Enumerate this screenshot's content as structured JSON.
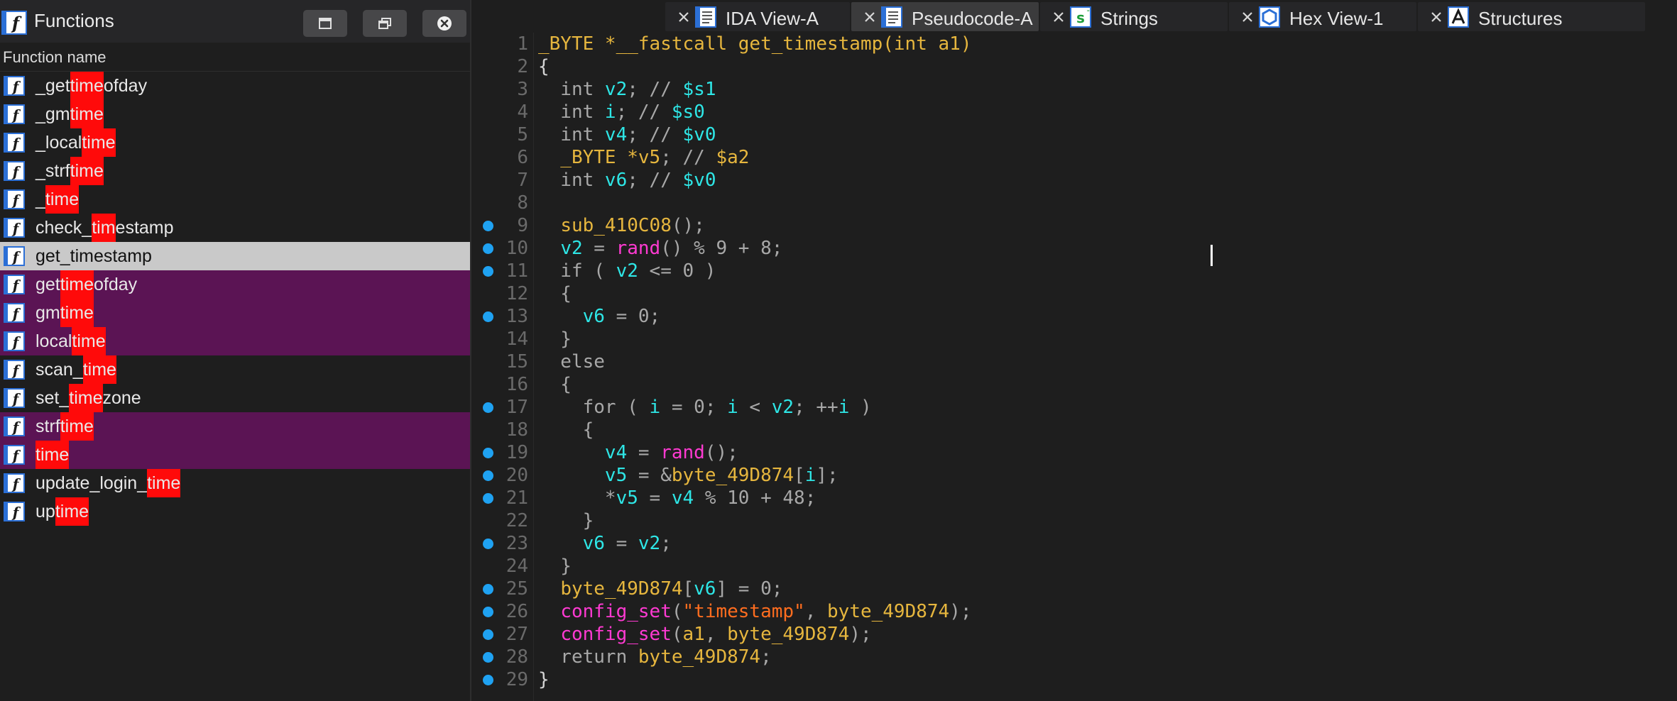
{
  "functions_panel": {
    "title": "Functions",
    "column_header": "Function name",
    "items": [
      {
        "segments": [
          {
            "t": "_get",
            "hl": false
          },
          {
            "t": "time",
            "hl": true
          },
          {
            "t": "ofday",
            "hl": false
          }
        ],
        "state": "normal"
      },
      {
        "segments": [
          {
            "t": "_gm",
            "hl": false
          },
          {
            "t": "time",
            "hl": true
          }
        ],
        "state": "normal"
      },
      {
        "segments": [
          {
            "t": "_local",
            "hl": false
          },
          {
            "t": "time",
            "hl": true
          }
        ],
        "state": "normal"
      },
      {
        "segments": [
          {
            "t": "_strf",
            "hl": false
          },
          {
            "t": "time",
            "hl": true
          }
        ],
        "state": "normal"
      },
      {
        "segments": [
          {
            "t": "_",
            "hl": false
          },
          {
            "t": "time",
            "hl": true
          }
        ],
        "state": "normal"
      },
      {
        "segments": [
          {
            "t": "check_",
            "hl": false
          },
          {
            "t": "tim",
            "hl": true
          },
          {
            "t": "estamp",
            "hl": false
          }
        ],
        "state": "normal"
      },
      {
        "segments": [
          {
            "t": "get_timestamp",
            "hl": false
          }
        ],
        "state": "selected"
      },
      {
        "segments": [
          {
            "t": "get",
            "hl": false
          },
          {
            "t": "time",
            "hl": true
          },
          {
            "t": "ofday",
            "hl": false
          }
        ],
        "state": "library"
      },
      {
        "segments": [
          {
            "t": "gm",
            "hl": false
          },
          {
            "t": "time",
            "hl": true
          }
        ],
        "state": "library"
      },
      {
        "segments": [
          {
            "t": "local",
            "hl": false
          },
          {
            "t": "time",
            "hl": true
          }
        ],
        "state": "library"
      },
      {
        "segments": [
          {
            "t": "scan_",
            "hl": false
          },
          {
            "t": "time",
            "hl": true
          }
        ],
        "state": "normal"
      },
      {
        "segments": [
          {
            "t": "set_",
            "hl": false
          },
          {
            "t": "time",
            "hl": true
          },
          {
            "t": "zone",
            "hl": false
          }
        ],
        "state": "normal"
      },
      {
        "segments": [
          {
            "t": "strf",
            "hl": false
          },
          {
            "t": "time",
            "hl": true
          }
        ],
        "state": "library"
      },
      {
        "segments": [
          {
            "t": "time",
            "hl": true
          }
        ],
        "state": "library"
      },
      {
        "segments": [
          {
            "t": "update_login_",
            "hl": false
          },
          {
            "t": "time",
            "hl": true
          }
        ],
        "state": "normal"
      },
      {
        "segments": [
          {
            "t": "up",
            "hl": false
          },
          {
            "t": "time",
            "hl": true
          }
        ],
        "state": "normal"
      }
    ]
  },
  "tabs": [
    {
      "label": "IDA View-A",
      "icon": "ida-view-icon",
      "active": false
    },
    {
      "label": "Pseudocode-A",
      "icon": "pseudocode-icon",
      "active": true
    },
    {
      "label": "Strings",
      "icon": "strings-icon",
      "active": false
    },
    {
      "label": "Hex View-1",
      "icon": "hex-view-icon",
      "active": false
    },
    {
      "label": "Structures",
      "icon": "structures-icon",
      "active": false
    }
  ],
  "code_lines": [
    {
      "n": "1",
      "bp": false,
      "tokens": [
        [
          "_BYTE *__fastcall get_timestamp(",
          "type"
        ],
        [
          "int",
          "type"
        ],
        [
          " a1)",
          "type"
        ]
      ]
    },
    {
      "n": "2",
      "bp": false,
      "tokens": [
        [
          "{",
          "txt"
        ]
      ]
    },
    {
      "n": "3",
      "bp": false,
      "tokens": [
        [
          "  int ",
          "var-dim"
        ],
        [
          "v2",
          "var"
        ],
        [
          "; // ",
          "dim"
        ],
        [
          "$s1",
          "var"
        ]
      ]
    },
    {
      "n": "4",
      "bp": false,
      "tokens": [
        [
          "  int ",
          "var-dim"
        ],
        [
          "i",
          "var"
        ],
        [
          "; // ",
          "dim"
        ],
        [
          "$s0",
          "var"
        ]
      ]
    },
    {
      "n": "5",
      "bp": false,
      "tokens": [
        [
          "  int ",
          "var-dim"
        ],
        [
          "v4",
          "var"
        ],
        [
          "; // ",
          "dim"
        ],
        [
          "$v0",
          "var"
        ]
      ]
    },
    {
      "n": "6",
      "bp": false,
      "tokens": [
        [
          "  _BYTE *",
          "type"
        ],
        [
          "v5",
          "type"
        ],
        [
          "; // ",
          "dim"
        ],
        [
          "$a2",
          "type"
        ]
      ]
    },
    {
      "n": "7",
      "bp": false,
      "tokens": [
        [
          "  int ",
          "var-dim"
        ],
        [
          "v6",
          "var"
        ],
        [
          "; // ",
          "dim"
        ],
        [
          "$v0",
          "var"
        ]
      ]
    },
    {
      "n": "8",
      "bp": false,
      "tokens": []
    },
    {
      "n": "9",
      "bp": true,
      "tokens": [
        [
          "  ",
          "txt"
        ],
        [
          "sub_410C08",
          "fn"
        ],
        [
          "();",
          "dim"
        ]
      ]
    },
    {
      "n": "10",
      "bp": true,
      "tokens": [
        [
          "  ",
          "txt"
        ],
        [
          "v2",
          "var"
        ],
        [
          " = ",
          "dim"
        ],
        [
          "rand",
          "call"
        ],
        [
          "() % 9 + 8;",
          "dim"
        ]
      ]
    },
    {
      "n": "11",
      "bp": true,
      "tokens": [
        [
          "  if ( ",
          "dim"
        ],
        [
          "v2",
          "var"
        ],
        [
          " <= 0 )",
          "dim"
        ]
      ]
    },
    {
      "n": "12",
      "bp": false,
      "tokens": [
        [
          "  {",
          "dim"
        ]
      ]
    },
    {
      "n": "13",
      "bp": true,
      "tokens": [
        [
          "    ",
          "txt"
        ],
        [
          "v6",
          "var"
        ],
        [
          " = 0;",
          "dim"
        ]
      ]
    },
    {
      "n": "14",
      "bp": false,
      "tokens": [
        [
          "  }",
          "dim"
        ]
      ]
    },
    {
      "n": "15",
      "bp": false,
      "tokens": [
        [
          "  else",
          "dim"
        ]
      ]
    },
    {
      "n": "16",
      "bp": false,
      "tokens": [
        [
          "  {",
          "dim"
        ]
      ]
    },
    {
      "n": "17",
      "bp": true,
      "tokens": [
        [
          "    for ( ",
          "dim"
        ],
        [
          "i",
          "var"
        ],
        [
          " = 0; ",
          "dim"
        ],
        [
          "i",
          "var"
        ],
        [
          " < ",
          "dim"
        ],
        [
          "v2",
          "var"
        ],
        [
          "; ++",
          "dim"
        ],
        [
          "i",
          "var"
        ],
        [
          " )",
          "dim"
        ]
      ]
    },
    {
      "n": "18",
      "bp": false,
      "tokens": [
        [
          "    {",
          "dim"
        ]
      ]
    },
    {
      "n": "19",
      "bp": true,
      "tokens": [
        [
          "      ",
          "txt"
        ],
        [
          "v4",
          "var"
        ],
        [
          " = ",
          "dim"
        ],
        [
          "rand",
          "call"
        ],
        [
          "();",
          "dim"
        ]
      ]
    },
    {
      "n": "20",
      "bp": true,
      "tokens": [
        [
          "      ",
          "txt"
        ],
        [
          "v5",
          "var"
        ],
        [
          " = &",
          "dim"
        ],
        [
          "byte_49D874",
          "fn"
        ],
        [
          "[",
          "dim"
        ],
        [
          "i",
          "var"
        ],
        [
          "];",
          "dim"
        ]
      ]
    },
    {
      "n": "21",
      "bp": true,
      "tokens": [
        [
          "      *",
          "dim"
        ],
        [
          "v5",
          "var"
        ],
        [
          " = ",
          "dim"
        ],
        [
          "v4",
          "var"
        ],
        [
          " % 10 + 48;",
          "dim"
        ]
      ]
    },
    {
      "n": "22",
      "bp": false,
      "tokens": [
        [
          "    }",
          "dim"
        ]
      ]
    },
    {
      "n": "23",
      "bp": true,
      "tokens": [
        [
          "    ",
          "txt"
        ],
        [
          "v6",
          "var"
        ],
        [
          " = ",
          "dim"
        ],
        [
          "v2",
          "var"
        ],
        [
          ";",
          "dim"
        ]
      ]
    },
    {
      "n": "24",
      "bp": false,
      "tokens": [
        [
          "  }",
          "dim"
        ]
      ]
    },
    {
      "n": "25",
      "bp": true,
      "tokens": [
        [
          "  ",
          "txt"
        ],
        [
          "byte_49D874",
          "fn"
        ],
        [
          "[",
          "dim"
        ],
        [
          "v6",
          "var"
        ],
        [
          "] = 0;",
          "dim"
        ]
      ]
    },
    {
      "n": "26",
      "bp": true,
      "tokens": [
        [
          "  ",
          "txt"
        ],
        [
          "config_set",
          "call"
        ],
        [
          "(",
          "dim"
        ],
        [
          "\"timestamp\"",
          "str"
        ],
        [
          ", ",
          "dim"
        ],
        [
          "byte_49D874",
          "fn"
        ],
        [
          ");",
          "dim"
        ]
      ]
    },
    {
      "n": "27",
      "bp": true,
      "tokens": [
        [
          "  ",
          "txt"
        ],
        [
          "config_set",
          "call"
        ],
        [
          "(",
          "dim"
        ],
        [
          "a1",
          "fn"
        ],
        [
          ", ",
          "dim"
        ],
        [
          "byte_49D874",
          "fn"
        ],
        [
          ");",
          "dim"
        ]
      ]
    },
    {
      "n": "28",
      "bp": true,
      "tokens": [
        [
          "  return ",
          "dim"
        ],
        [
          "byte_49D874",
          "fn"
        ],
        [
          ";",
          "dim"
        ]
      ]
    },
    {
      "n": "29",
      "bp": true,
      "tokens": [
        [
          "}",
          "txt"
        ]
      ]
    }
  ],
  "colors": {
    "background": "#1e1e1e",
    "search_highlight": "#ff0a0a",
    "selected_row": "#c9c9c9",
    "library_row": "#5b1454",
    "breakpoint": "#1fa2f2",
    "type": "#e6b63e",
    "variable": "#2ee6e6",
    "call": "#ff3ad2",
    "string": "#ff6d1f"
  }
}
